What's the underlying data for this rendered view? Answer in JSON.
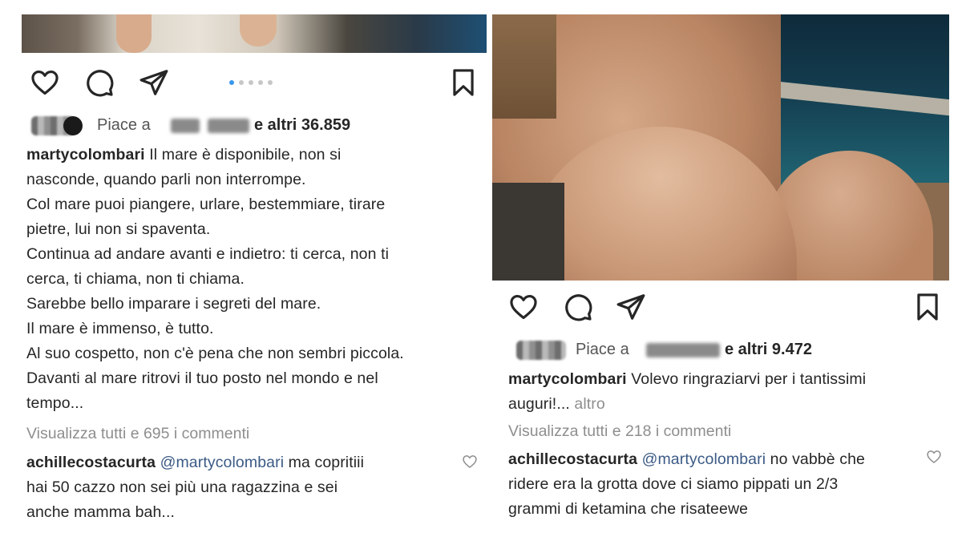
{
  "posts": [
    {
      "likes": {
        "prefix": "Piace a",
        "suffix": "e altri 36.859"
      },
      "caption": {
        "username": "martycolombari",
        "lines": [
          "Il mare è disponibile, non si",
          "nasconde, quando parli non interrompe.",
          "Col mare puoi piangere, urlare, bestemmiare, tirare",
          "pietre, lui non si spaventa.",
          "Continua ad andare avanti e indietro: ti cerca, non ti",
          "cerca, ti chiama, non ti chiama.",
          "Sarebbe bello imparare i segreti del mare.",
          "Il mare è immenso, è tutto.",
          "Al suo cospetto, non c'è pena che non sembri piccola.",
          "Davanti al mare ritrovi il tuo posto nel mondo e nel",
          "tempo..."
        ]
      },
      "view_all": "Visualizza tutti e 695 i commenti",
      "comment": {
        "username": "achillecostacurta",
        "mention": "@martycolombari",
        "first": " ma copritiii",
        "lines": [
          "hai 50 cazzo non sei più una ragazzina e sei",
          "anche mamma bah..."
        ]
      }
    },
    {
      "likes": {
        "prefix": "Piace a",
        "suffix": "e altri 9.472"
      },
      "caption": {
        "username": "martycolombari",
        "first": " Volevo ringraziarvi per i tantissimi",
        "second": "auguri!...",
        "more": " altro"
      },
      "view_all": "Visualizza tutti e 218 i commenti",
      "comment": {
        "username": "achillecostacurta",
        "mention": "@martycolombari",
        "first": " no vabbè che",
        "lines": [
          "ridere era la grotta dove ci siamo pippati un 2/3",
          "grammi di ketamina che risateewe"
        ]
      }
    }
  ],
  "icons": [
    "heart-icon",
    "comment-icon",
    "share-icon",
    "bookmark-icon"
  ],
  "colors": {
    "text": "#262626",
    "muted": "#8e8e8e",
    "mention": "#3b5a85",
    "carousel_active": "#3897f0"
  }
}
